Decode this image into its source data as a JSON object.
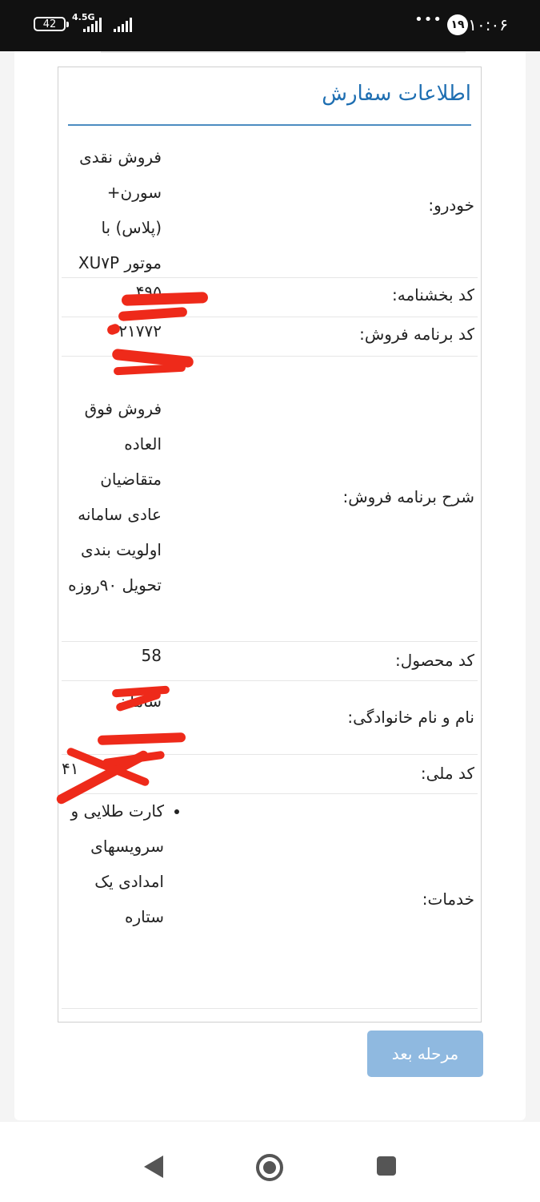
{
  "status_bar": {
    "battery": "42",
    "network": "4.5G",
    "notification_count": "۱۹",
    "overflow": "•••",
    "time": "۱۰:۰۶"
  },
  "order_panel": {
    "title": "اطلاعات سفارش",
    "rows": {
      "car": {
        "label": "خودرو:",
        "value": "فروش نقدی سورن+ (پلاس) با موتور XU۷P"
      },
      "agency_code": {
        "label": "کد بخشنامه:",
        "value": "۴۹۵"
      },
      "sale_program_code": {
        "label": "کد برنامه فروش:",
        "value": "۲۱۷۷۲"
      },
      "sale_program_desc": {
        "label": "شرح برنامه فروش:",
        "value": "فروش فوق العاده متقاضیان عادی سامانه اولویت بندی تحویل ۹۰روزه"
      },
      "product_code": {
        "label": "کد محصول:",
        "value": "58"
      },
      "full_name": {
        "label": "نام و نام خانوادگی:",
        "value": "سامان"
      },
      "national_id": {
        "label": "کد ملی:",
        "value": "۴۱"
      },
      "services": {
        "label": "خدمات:",
        "items": [
          "کارت طلایی و سرویسهای امدادی یک ستاره"
        ]
      }
    }
  },
  "next_button": {
    "label": "مرحله بعد"
  },
  "colors": {
    "accent": "#1f6fb2",
    "button": "#8fb9e0",
    "redaction": "#ee2a1a"
  },
  "icons": [
    "battery-icon",
    "signal-icon",
    "notification-badge",
    "nav-back-icon",
    "nav-home-icon",
    "nav-recents-icon"
  ]
}
